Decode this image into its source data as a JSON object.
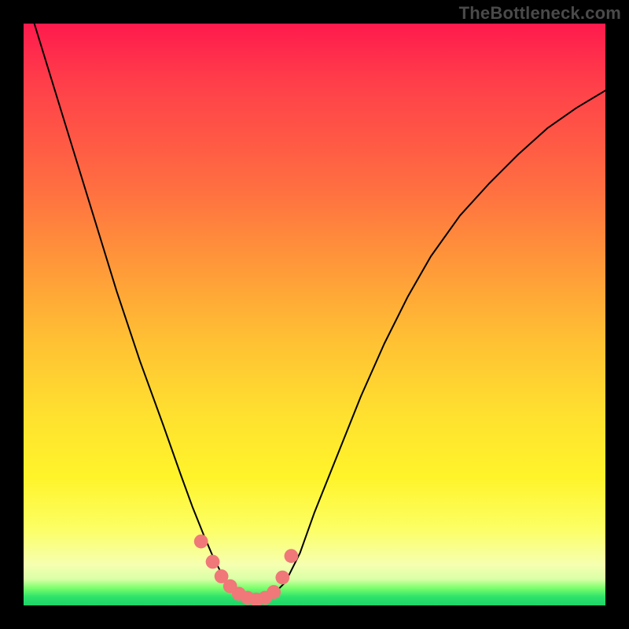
{
  "watermark": "TheBottleneck.com",
  "chart_data": {
    "type": "line",
    "title": "",
    "xlabel": "",
    "ylabel": "",
    "xlim": [
      0,
      1
    ],
    "ylim": [
      0,
      1
    ],
    "colors": {
      "curve": "#000000",
      "markers": "#f07878",
      "gradient_top": "#ff1a4d",
      "gradient_mid": "#ffe22f",
      "gradient_bottom": "#1dd469"
    },
    "series": [
      {
        "name": "bottleneck-curve",
        "x": [
          0.0,
          0.04,
          0.08,
          0.12,
          0.16,
          0.2,
          0.24,
          0.27,
          0.29,
          0.31,
          0.325,
          0.34,
          0.355,
          0.37,
          0.385,
          0.4,
          0.415,
          0.43,
          0.45,
          0.475,
          0.5,
          0.54,
          0.58,
          0.62,
          0.66,
          0.7,
          0.75,
          0.8,
          0.85,
          0.9,
          0.95,
          1.0
        ],
        "y": [
          1.06,
          0.93,
          0.8,
          0.67,
          0.54,
          0.42,
          0.31,
          0.225,
          0.17,
          0.12,
          0.085,
          0.055,
          0.033,
          0.02,
          0.012,
          0.01,
          0.012,
          0.02,
          0.04,
          0.09,
          0.16,
          0.26,
          0.36,
          0.45,
          0.53,
          0.6,
          0.67,
          0.725,
          0.775,
          0.82,
          0.855,
          0.885
        ]
      }
    ],
    "markers": {
      "name": "highlight-points",
      "x": [
        0.305,
        0.325,
        0.34,
        0.355,
        0.37,
        0.385,
        0.4,
        0.415,
        0.43,
        0.445,
        0.46
      ],
      "y": [
        0.11,
        0.075,
        0.05,
        0.033,
        0.02,
        0.013,
        0.01,
        0.013,
        0.023,
        0.048,
        0.085
      ],
      "r": 0.012
    }
  }
}
